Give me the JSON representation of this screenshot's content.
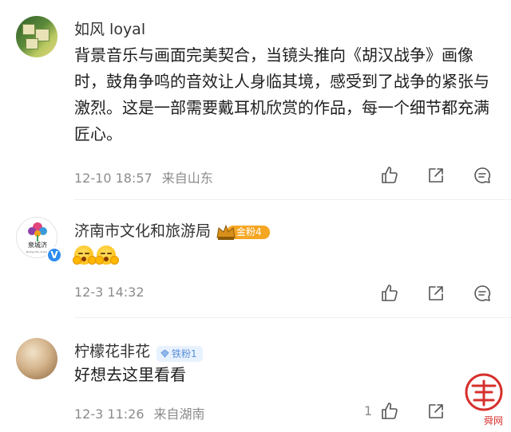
{
  "comments": [
    {
      "username": "如风 loyal",
      "text": "背景音乐与画面完美契合，当镜头推向《胡汉战争》画像时，鼓角争鸣的音效让人身临其境，感受到了战争的紧张与激烈。这是一部需要戴耳机欣赏的作品，每一个细节都充满匠心。",
      "time": "12-10 18:57",
      "location": "来自山东"
    },
    {
      "username": "济南市文化和旅游局",
      "crown_badge": "金粉4",
      "avatar_text": "泉城济",
      "avatar_subtext": "Spring City of Jinan",
      "time": "12-3 14:32",
      "verified": "V"
    },
    {
      "username": "柠檬花非花",
      "fan_badge": "铁粉1",
      "text": "好想去这里看看",
      "time": "12-3 11:26",
      "location": "来自湖南",
      "like_count": "1"
    }
  ],
  "watermark_text": "舜网",
  "colors": {
    "name": "#333333",
    "text": "#1e1e1e",
    "meta": "#8c8c8c",
    "crown_badge_bg": "#f5a623",
    "fan_badge_bg": "#e8f2ff",
    "fan_badge_fg": "#5a8fd6",
    "verified": "#2c8bf0",
    "watermark": "#d6302c"
  },
  "icons": [
    "like-icon",
    "share-icon",
    "comment-icon",
    "crown-icon",
    "diamond-icon",
    "verified-icon"
  ]
}
